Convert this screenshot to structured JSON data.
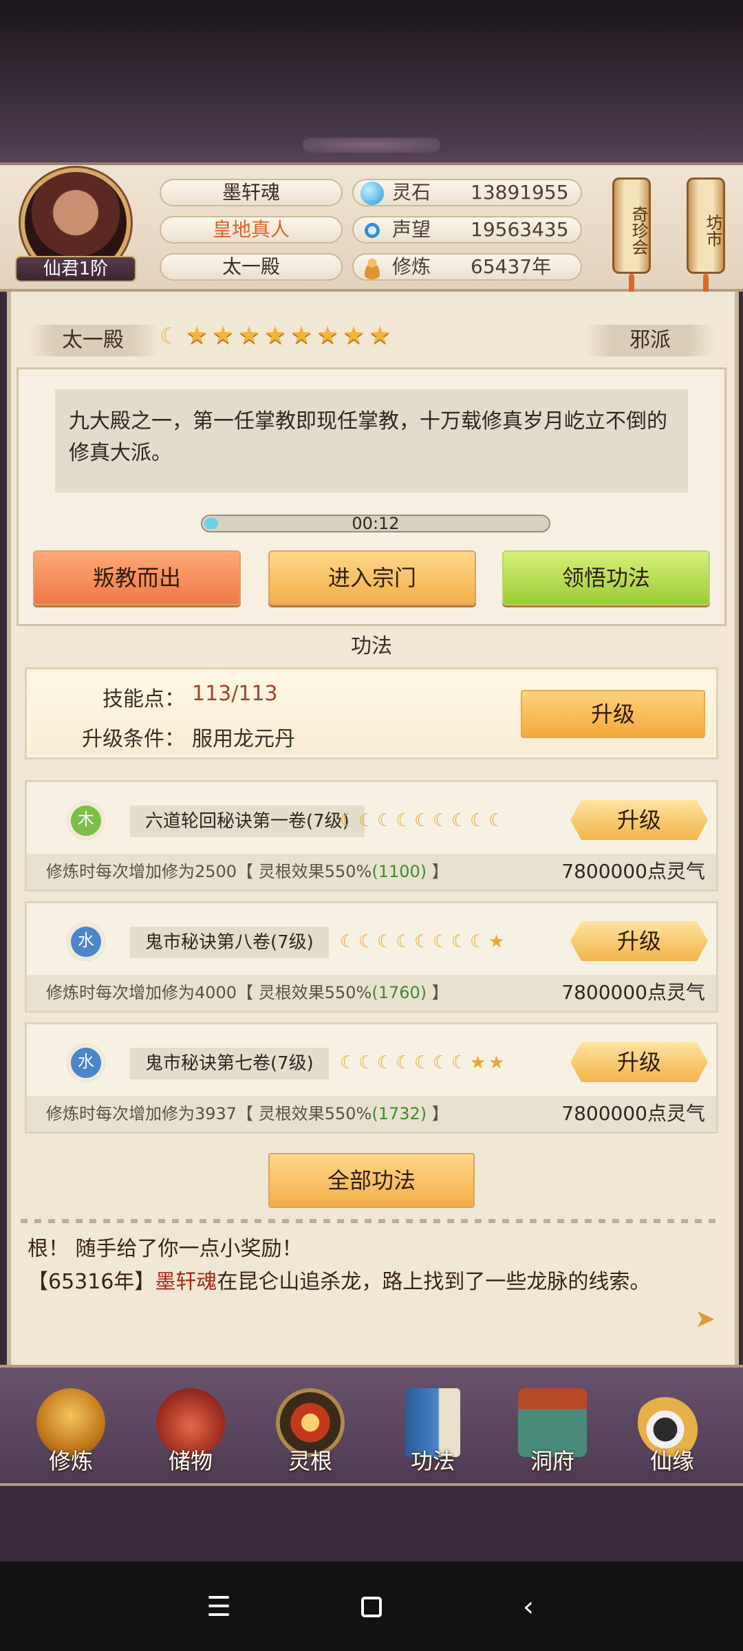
{
  "header": {
    "name": "墨轩魂",
    "title": "皇地真人",
    "sect": "太一殿",
    "rank": "仙君1阶",
    "stats": [
      {
        "icon": "spirit-stone-icon",
        "label": "灵石",
        "value": "13891955"
      },
      {
        "icon": "reputation-icon",
        "label": "声望",
        "value": "19563435"
      },
      {
        "icon": "cultivation-icon",
        "label": "修炼",
        "value": "65437年"
      }
    ],
    "side_buttons": [
      "奇珍会",
      "坊市"
    ]
  },
  "sect_panel": {
    "name": "太一殿",
    "rating": {
      "moons": 1,
      "stars": 8
    },
    "alignment": "邪派",
    "description": "九大殿之一，第一任掌教即现任掌教，十万载修真岁月屹立不倒的修真大派。",
    "timer": "00:12",
    "timer_progress": 0.04,
    "buttons": {
      "leave": "叛教而出",
      "enter": "进入宗门",
      "comprehend": "领悟功法"
    }
  },
  "skills_section": {
    "title": "功法",
    "points_label": "技能点：",
    "points_value": "113/113",
    "condition_label": "升级条件：",
    "condition_value": "服用龙元丹",
    "upgrade_label": "升级"
  },
  "skills": [
    {
      "element": "木",
      "element_color": "#7ebd4a",
      "name": "六道轮回秘诀第一卷(7级)",
      "rating": {
        "moons": 9,
        "stars": 0
      },
      "upgrade": "升级",
      "effect_prefix": "修炼时每次增加修为2500【 灵根效果550%",
      "effect_bonus": "(1100)",
      "effect_suffix": " 】",
      "cost": "7800000点灵气"
    },
    {
      "element": "水",
      "element_color": "#4a86c8",
      "name": "鬼市秘诀第八卷(7级)",
      "rating": {
        "moons": 8,
        "stars": 1
      },
      "upgrade": "升级",
      "effect_prefix": "修炼时每次增加修为4000【 灵根效果550%",
      "effect_bonus": "(1760)",
      "effect_suffix": " 】",
      "cost": "7800000点灵气"
    },
    {
      "element": "水",
      "element_color": "#4a86c8",
      "name": "鬼市秘诀第七卷(7级)",
      "rating": {
        "moons": 7,
        "stars": 2
      },
      "upgrade": "升级",
      "effect_prefix": "修炼时每次增加修为3937【 灵根效果550%",
      "effect_bonus": "(1732)",
      "effect_suffix": " 】",
      "cost": "7800000点灵气"
    }
  ],
  "all_skills_label": "全部功法",
  "log": {
    "line1": "根！ 随手给了你一点小奖励！",
    "line2_prefix": "【65316年】",
    "line2_name": "墨轩魂",
    "line2_suffix": "在昆仑山追杀龙，路上找到了一些龙脉的线索。"
  },
  "nav": [
    {
      "icon": "cultivate-icon",
      "label": "修炼"
    },
    {
      "icon": "storage-bag-icon",
      "label": "储物"
    },
    {
      "icon": "spirit-root-icon",
      "label": "灵根"
    },
    {
      "icon": "skill-book-icon",
      "label": "功法"
    },
    {
      "icon": "cave-dwelling-icon",
      "label": "洞府"
    },
    {
      "icon": "destiny-icon",
      "label": "仙缘"
    }
  ],
  "colors": {
    "accent_orange": "#f2ae48",
    "green_button": "#9bcd35",
    "red_button": "#f07845",
    "title_orange": "#d9642a"
  }
}
